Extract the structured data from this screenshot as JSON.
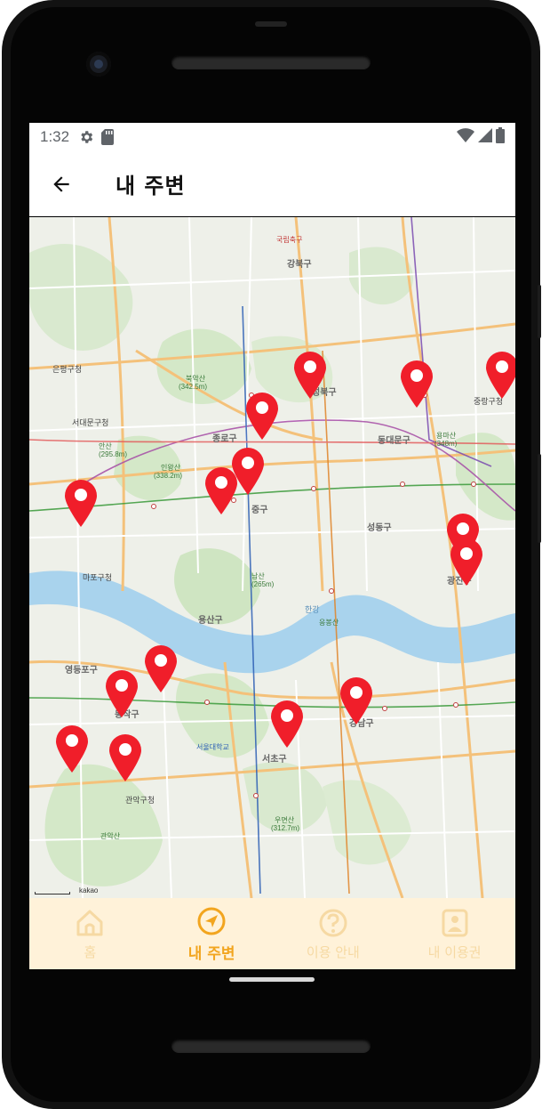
{
  "status_bar": {
    "time": "1:32"
  },
  "app_bar": {
    "title": "내 주변"
  },
  "map": {
    "credit": "kakao",
    "labels": [
      {
        "text": "국립축구",
        "sub": ""
      },
      {
        "text": "강북구",
        "sub": ""
      },
      {
        "text": "성북구",
        "sub": ""
      },
      {
        "text": "종로구",
        "sub": ""
      },
      {
        "text": "동대문구",
        "sub": ""
      },
      {
        "text": "중구",
        "sub": ""
      },
      {
        "text": "용산구",
        "sub": ""
      },
      {
        "text": "성동구",
        "sub": ""
      },
      {
        "text": "광진구",
        "sub": ""
      },
      {
        "text": "은평구청",
        "sub": ""
      },
      {
        "text": "서대문구청",
        "sub": ""
      },
      {
        "text": "마포구청",
        "sub": ""
      },
      {
        "text": "영등포구",
        "sub": ""
      },
      {
        "text": "동작구",
        "sub": ""
      },
      {
        "text": "서초구",
        "sub": ""
      },
      {
        "text": "강남구",
        "sub": ""
      },
      {
        "text": "관악구청",
        "sub": ""
      },
      {
        "text": "중랑구청",
        "sub": ""
      },
      {
        "text": "북악산",
        "sub": "(342.5m)"
      },
      {
        "text": "인왕산",
        "sub": "(338.2m)"
      },
      {
        "text": "남산",
        "sub": "(265m)"
      },
      {
        "text": "우면산",
        "sub": "(312.7m)"
      },
      {
        "text": "안산",
        "sub": "(295.8m)"
      },
      {
        "text": "관악산",
        "sub": ""
      },
      {
        "text": "용마산",
        "sub": "(348m)"
      },
      {
        "text": "응봉산",
        "sub": ""
      },
      {
        "text": "서울대학교",
        "sub": ""
      },
      {
        "text": "한강",
        "sub": ""
      }
    ]
  },
  "nav": {
    "items": [
      {
        "label": "홈",
        "icon": "home-icon",
        "active": false
      },
      {
        "label": "내 주변",
        "icon": "location-nav-icon",
        "active": true
      },
      {
        "label": "이용 안내",
        "icon": "help-icon",
        "active": false
      },
      {
        "label": "내 이용권",
        "icon": "ticket-icon",
        "active": false
      }
    ]
  },
  "colors": {
    "accent": "#f2a51f",
    "inactive": "#f6d9a3",
    "nav_bg": "#fff2d9",
    "pin": "#f01e2a"
  }
}
